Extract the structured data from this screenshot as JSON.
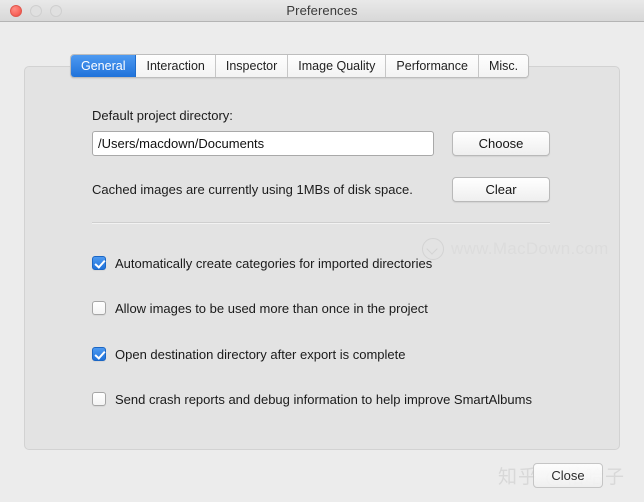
{
  "window": {
    "title": "Preferences",
    "traffic_lights": [
      "close",
      "minimize",
      "maximize"
    ]
  },
  "tabs": [
    {
      "label": "General",
      "active": true
    },
    {
      "label": "Interaction",
      "active": false
    },
    {
      "label": "Inspector",
      "active": false
    },
    {
      "label": "Image Quality",
      "active": false
    },
    {
      "label": "Performance",
      "active": false
    },
    {
      "label": "Misc.",
      "active": false
    }
  ],
  "general": {
    "directory_label": "Default project directory:",
    "directory_value": "/Users/macdown/Documents",
    "directory_placeholder": "/Users/macdown/Documents",
    "choose_label": "Choose",
    "cache_text": "Cached images are currently using 1MBs of disk space.",
    "clear_label": "Clear",
    "checkboxes": [
      {
        "label": "Automatically create categories for imported directories",
        "checked": true
      },
      {
        "label": "Allow images to be used more than once in the project",
        "checked": false
      },
      {
        "label": "Open destination directory after export is complete",
        "checked": true
      },
      {
        "label": "Send crash reports and debug information to help improve SmartAlbums",
        "checked": false
      }
    ]
  },
  "footer": {
    "close_label": "Close"
  },
  "watermarks": {
    "macdown": "www.MacDown.com",
    "zhihu": "知乎 @帕哈子"
  },
  "colors": {
    "accent_blue": "#1f72da",
    "accent_blue_light": "#4e9af1",
    "window_bg": "#ececec",
    "panel_bg": "#e3e3e3",
    "close_light": "#f9655c"
  }
}
